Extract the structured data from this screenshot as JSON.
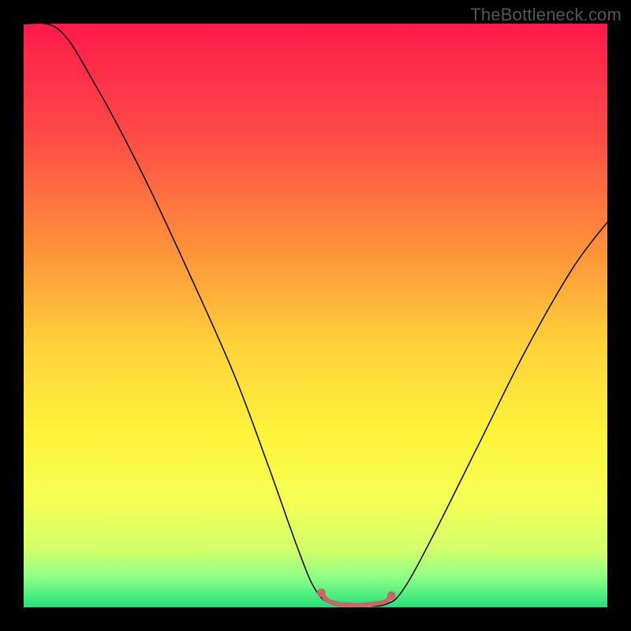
{
  "watermark": "TheBottleneck.com",
  "chart_data": {
    "type": "line",
    "title": "",
    "xlabel": "",
    "ylabel": "",
    "xlim": [
      0,
      100
    ],
    "ylim": [
      0,
      100
    ],
    "background_gradient": {
      "stops": [
        {
          "offset": 0,
          "color": "#ff1a4b"
        },
        {
          "offset": 18,
          "color": "#ff4747"
        },
        {
          "offset": 38,
          "color": "#ff8f3b"
        },
        {
          "offset": 55,
          "color": "#ffd23a"
        },
        {
          "offset": 70,
          "color": "#fff23a"
        },
        {
          "offset": 82,
          "color": "#f4ff55"
        },
        {
          "offset": 90,
          "color": "#d4ff6a"
        },
        {
          "offset": 95,
          "color": "#8bff88"
        },
        {
          "offset": 100,
          "color": "#22e07a"
        }
      ]
    },
    "series": [
      {
        "name": "bottleneck-curve",
        "color": "#000000",
        "stroke_width": 1.5,
        "points": [
          {
            "x": 0,
            "y": 100
          },
          {
            "x": 6,
            "y": 99
          },
          {
            "x": 12,
            "y": 90
          },
          {
            "x": 20,
            "y": 75
          },
          {
            "x": 28,
            "y": 58
          },
          {
            "x": 36,
            "y": 40
          },
          {
            "x": 42,
            "y": 24
          },
          {
            "x": 47,
            "y": 10
          },
          {
            "x": 50,
            "y": 3
          },
          {
            "x": 53,
            "y": 0.5
          },
          {
            "x": 58,
            "y": 0.3
          },
          {
            "x": 62,
            "y": 0.5
          },
          {
            "x": 65,
            "y": 3
          },
          {
            "x": 70,
            "y": 12
          },
          {
            "x": 78,
            "y": 28
          },
          {
            "x": 86,
            "y": 44
          },
          {
            "x": 94,
            "y": 58
          },
          {
            "x": 100,
            "y": 66
          }
        ]
      },
      {
        "name": "optimal-marker",
        "color": "#cc6666",
        "stroke_width": 6,
        "points": [
          {
            "x": 51,
            "y": 2.5
          },
          {
            "x": 52,
            "y": 1.2
          },
          {
            "x": 54,
            "y": 0.6
          },
          {
            "x": 56,
            "y": 0.4
          },
          {
            "x": 58,
            "y": 0.4
          },
          {
            "x": 60,
            "y": 0.6
          },
          {
            "x": 62,
            "y": 1.0
          },
          {
            "x": 63,
            "y": 2.0
          }
        ],
        "endpoints": [
          {
            "x": 51,
            "y": 2.5
          },
          {
            "x": 63,
            "y": 2.0
          }
        ]
      }
    ]
  }
}
